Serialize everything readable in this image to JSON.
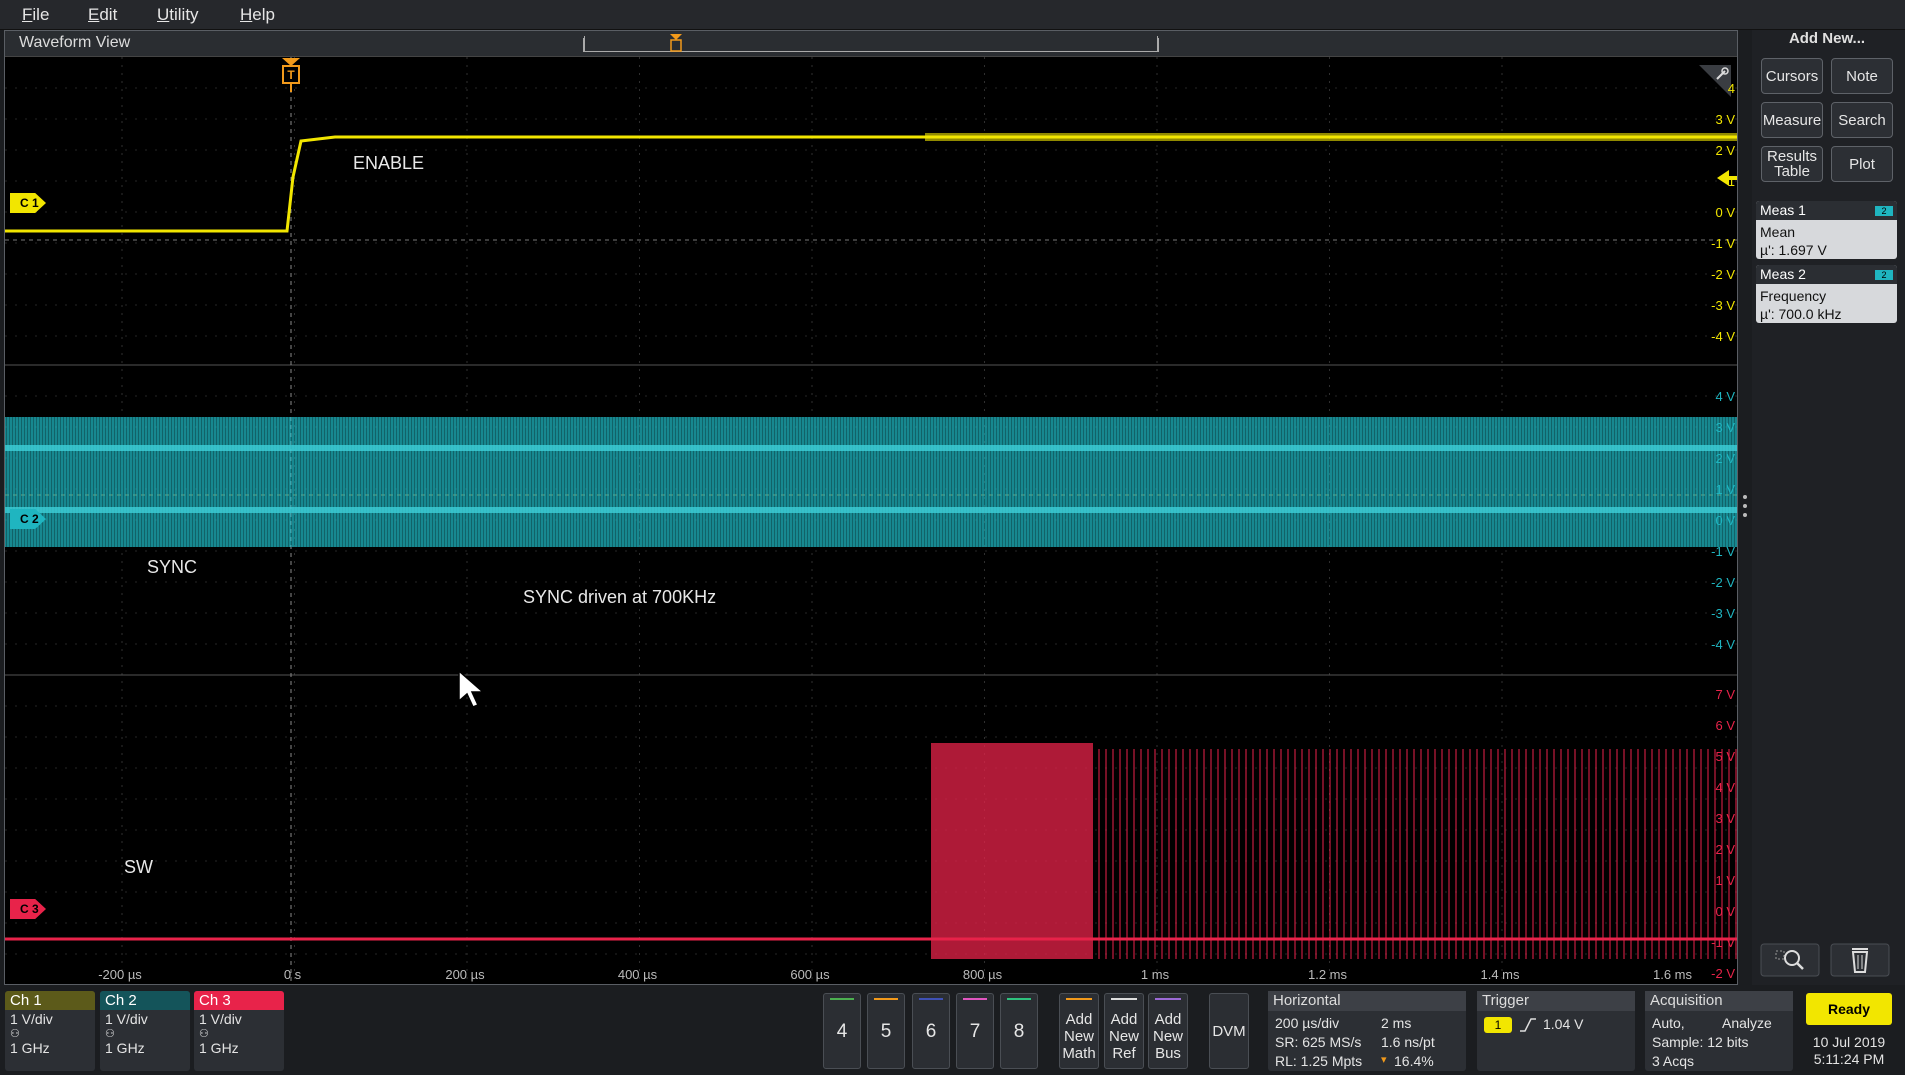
{
  "menu": [
    {
      "label": "File",
      "underline": "F",
      "rest": "ile"
    },
    {
      "label": "Edit",
      "underline": "E",
      "rest": "dit"
    },
    {
      "label": "Utility",
      "underline": "U",
      "rest": "tility"
    },
    {
      "label": "Help",
      "underline": "H",
      "rest": "elp"
    }
  ],
  "waveform_view": {
    "title": "Waveform View",
    "trigger_marker": "T",
    "labels": {
      "enable": "ENABLE",
      "sync": "SYNC",
      "sync_note": "SYNC driven at 700KHz",
      "sw": "SW"
    },
    "ch1_scale": [
      "4",
      "3 V",
      "2 V",
      "1",
      "0 V",
      "-1 V",
      "-2 V",
      "-3 V",
      "-4 V"
    ],
    "ch2_scale": [
      "4 V",
      "3 V",
      "2 V",
      "1 V",
      "0 V",
      "-1 V",
      "-2 V",
      "-3 V",
      "-4 V"
    ],
    "ch3_scale": [
      "7 V",
      "6 V",
      "5 V",
      "4 V",
      "3 V",
      "2 V",
      "1 V",
      "0 V",
      "-1 V",
      "-2 V"
    ],
    "time_axis": [
      "-200 µs",
      "0 s",
      "200 µs",
      "400 µs",
      "600 µs",
      "800 µs",
      "1 ms",
      "1.2 ms",
      "1.4 ms",
      "1.6 ms"
    ],
    "channel_markers": [
      "C 1",
      "C 2",
      "C 3"
    ],
    "colors": {
      "ch1": "#f2e600",
      "ch2": "#1fb5c0",
      "ch3": "#e8234a",
      "trigger": "#f29a1b"
    }
  },
  "right_panel": {
    "add_new": "Add New...",
    "buttons": [
      "Cursors",
      "Note",
      "Measure",
      "Search",
      "Results Table",
      "Plot"
    ],
    "measurements": [
      {
        "name": "Meas 1",
        "badge": "2",
        "type": "Mean",
        "value": "µ': 1.697 V"
      },
      {
        "name": "Meas 2",
        "badge": "2",
        "type": "Frequency",
        "value": "µ': 700.0 kHz"
      }
    ],
    "tools": [
      "zoom-icon",
      "trash-icon"
    ]
  },
  "bottom": {
    "channels": [
      {
        "name": "Ch 1",
        "scale": "1 V/div",
        "bw": "1 GHz",
        "color": "#f2e600"
      },
      {
        "name": "Ch 2",
        "scale": "1 V/div",
        "bw": "1 GHz",
        "color": "#1fb5c0"
      },
      {
        "name": "Ch 3",
        "scale": "1 V/div",
        "bw": "1 GHz",
        "color": "#e8234a"
      }
    ],
    "num_buttons": [
      {
        "label": "4",
        "color": "#4caf50"
      },
      {
        "label": "5",
        "color": "#f29a1b"
      },
      {
        "label": "6",
        "color": "#3f51b5"
      },
      {
        "label": "7",
        "color": "#e056c0"
      },
      {
        "label": "8",
        "color": "#2ec27e"
      }
    ],
    "add_buttons": [
      {
        "line1": "Add",
        "line2": "New",
        "line3": "Math",
        "color": "#f29a1b"
      },
      {
        "line1": "Add",
        "line2": "New",
        "line3": "Ref",
        "color": "#dddddd"
      },
      {
        "line1": "Add",
        "line2": "New",
        "line3": "Bus",
        "color": "#9c6ad6"
      }
    ],
    "dvm": "DVM",
    "horizontal": {
      "title": "Horizontal",
      "row1a": "200 µs/div",
      "row1b": "2 ms",
      "row2a": "SR: 625 MS/s",
      "row2b": "1.6 ns/pt",
      "row3a": "RL: 1.25 Mpts",
      "row3b": "16.4%"
    },
    "trigger": {
      "title": "Trigger",
      "source": "1",
      "level": "1.04 V"
    },
    "acquisition": {
      "title": "Acquisition",
      "row1a": "Auto,",
      "row1b": "Analyze",
      "row2": "Sample: 12 bits",
      "row3": "3 Acqs"
    },
    "status": {
      "state": "Ready",
      "date": "10 Jul 2019",
      "time": "5:11:24 PM"
    }
  }
}
